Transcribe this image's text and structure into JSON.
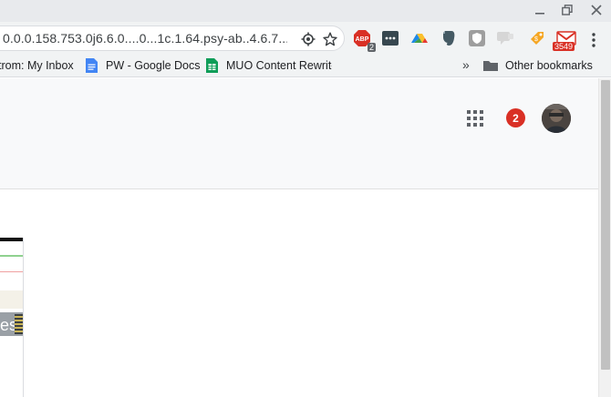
{
  "window": {
    "minimize_icon": "minimize-icon",
    "restore_icon": "restore-icon",
    "close_icon": "close-icon"
  },
  "omnibox": {
    "url": "0.0.0.158.753.0j6.6.0....0...1c.1.64.psy-ab..4.6.7...",
    "icons": [
      "location-target-icon",
      "bookmark-star-icon"
    ]
  },
  "extensions": {
    "adblock": {
      "label": "ABP",
      "badge": "2"
    },
    "gmail": {
      "badge": "3549"
    },
    "icons": [
      "adblock-plus-icon",
      "ellipsis-extension-icon",
      "google-drive-icon",
      "evernote-icon",
      "shield-extension-icon",
      "comment-extension-icon",
      "honey-icon",
      "gmail-checker-icon",
      "chrome-menu-icon"
    ]
  },
  "bookmarks": {
    "items": [
      {
        "label": "trom: My Inbox"
      },
      {
        "label": "PW - Google Docs"
      },
      {
        "label": "MUO Content Rewrite"
      }
    ],
    "overflow": "»",
    "other": "Other bookmarks"
  },
  "header": {
    "notifications_count": "2",
    "apps_icon": "apps-grid-icon",
    "avatar": "account-avatar"
  },
  "thumbnail": {
    "text": "es"
  },
  "colors": {
    "notification": "#d93025",
    "toolbar": "#f1f3f4",
    "gbar": "#f8f9fa"
  }
}
